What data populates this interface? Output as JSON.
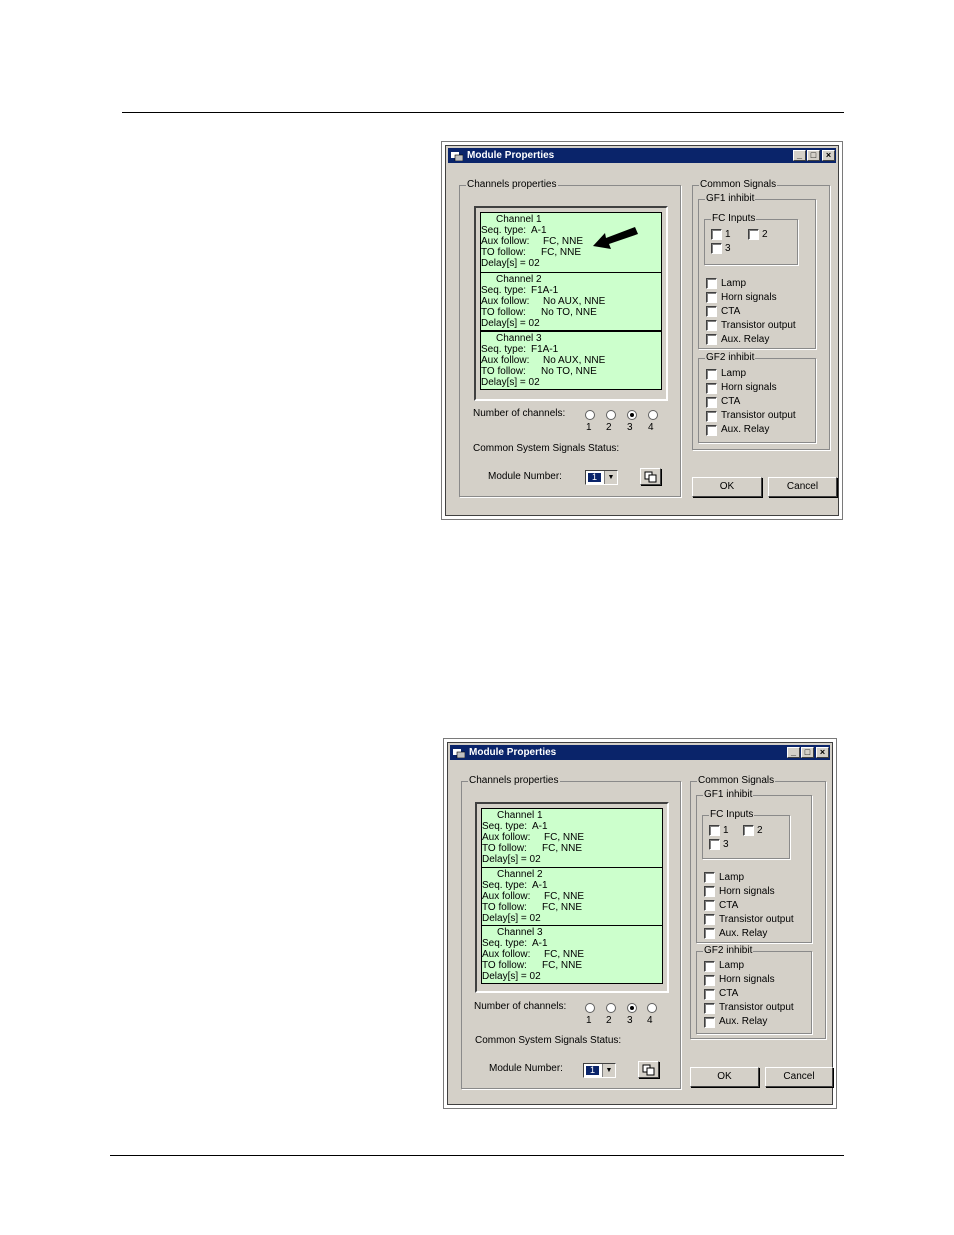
{
  "dialogs": [
    {
      "title": "Module Properties",
      "title_buttons": [
        "_",
        "□",
        "×"
      ],
      "channels_group_label": "Channels properties",
      "channels": [
        {
          "name": "Channel  1",
          "seq_label": "Seq. type:",
          "seq_value": "A-1",
          "aux_label": "Aux follow:",
          "aux_value": "FC, NNE",
          "to_label": "TO follow:",
          "to_value": "FC, NNE",
          "delay": "Delay[s] = 02"
        },
        {
          "name": "Channel  2",
          "seq_label": "Seq. type:",
          "seq_value": "F1A-1",
          "aux_label": "Aux follow:",
          "aux_value": "No AUX, NNE",
          "to_label": "TO follow:",
          "to_value": "No TO, NNE",
          "delay": "Delay[s] = 02"
        },
        {
          "name": "Channel  3",
          "seq_label": "Seq. type:",
          "seq_value": "F1A-1",
          "aux_label": "Aux follow:",
          "aux_value": "No AUX, NNE",
          "to_label": "TO follow:",
          "to_value": "No TO, NNE",
          "delay": "Delay[s] = 02"
        }
      ],
      "num_channels_label": "Number of channels:",
      "num_channel_options": [
        "1",
        "2",
        "3",
        "4"
      ],
      "num_channels_selected": "3",
      "common_status_label": "Common System Signals Status:",
      "module_number_label": "Module Number:",
      "module_number_value": "1",
      "common_signals_label": "Common  Signals",
      "gf1_label": "GF1 inhibit",
      "fc_inputs_label": "FC Inputs",
      "fc_inputs": [
        "1",
        "2",
        "3"
      ],
      "gf1_items": [
        "Lamp",
        "Horn signals",
        "CTA",
        "Transistor output",
        "Aux. Relay"
      ],
      "gf2_label": "GF2 inhibit",
      "gf2_items": [
        "Lamp",
        "Horn signals",
        "CTA",
        "Transistor output",
        "Aux. Relay"
      ],
      "ok_label": "OK",
      "cancel_label": "Cancel",
      "has_arrow": true
    },
    {
      "title": "Module Properties",
      "title_buttons": [
        "_",
        "□",
        "×"
      ],
      "channels_group_label": "Channels properties",
      "channels": [
        {
          "name": "Channel  1",
          "seq_label": "Seq. type:",
          "seq_value": "A-1",
          "aux_label": "Aux follow:",
          "aux_value": "FC, NNE",
          "to_label": "TO follow:",
          "to_value": "FC, NNE",
          "delay": "Delay[s] = 02"
        },
        {
          "name": "Channel  2",
          "seq_label": "Seq. type:",
          "seq_value": "A-1",
          "aux_label": "Aux follow:",
          "aux_value": "FC, NNE",
          "to_label": "TO follow:",
          "to_value": "FC, NNE",
          "delay": "Delay[s] = 02"
        },
        {
          "name": "Channel  3",
          "seq_label": "Seq. type:",
          "seq_value": "A-1",
          "aux_label": "Aux follow:",
          "aux_value": "FC, NNE",
          "to_label": "TO follow:",
          "to_value": "FC, NNE",
          "delay": "Delay[s] = 02"
        }
      ],
      "num_channels_label": "Number of channels:",
      "num_channel_options": [
        "1",
        "2",
        "3",
        "4"
      ],
      "num_channels_selected": "3",
      "common_status_label": "Common System Signals Status:",
      "module_number_label": "Module Number:",
      "module_number_value": "1",
      "common_signals_label": "Common  Signals",
      "gf1_label": "GF1 inhibit",
      "fc_inputs_label": "FC Inputs",
      "fc_inputs": [
        "1",
        "2",
        "3"
      ],
      "gf1_items": [
        "Lamp",
        "Horn signals",
        "CTA",
        "Transistor output",
        "Aux. Relay"
      ],
      "gf2_label": "GF2 inhibit",
      "gf2_items": [
        "Lamp",
        "Horn signals",
        "CTA",
        "Transistor output",
        "Aux. Relay"
      ],
      "ok_label": "OK",
      "cancel_label": "Cancel",
      "has_arrow": false
    }
  ]
}
